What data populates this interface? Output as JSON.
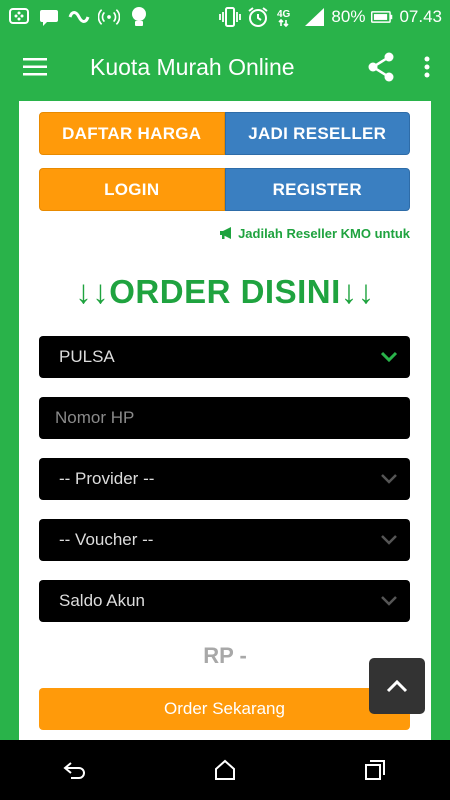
{
  "status_bar": {
    "icons_left": [
      "bbm-icon",
      "chat-icon",
      "sync-icon",
      "nfc-icon",
      "bulb-icon"
    ],
    "icons_right": [
      "vibrate-icon",
      "alarm-icon",
      "network-4g-icon",
      "signal-icon"
    ],
    "battery": "80%",
    "time": "07.43"
  },
  "app_bar": {
    "title": "Kuota Murah Online"
  },
  "buttons": {
    "daftar_harga": "DAFTAR HARGA",
    "jadi_reseller": "JADI RESELLER",
    "login": "LOGIN",
    "register": "REGISTER"
  },
  "notice": "Jadilah Reseller KMO untuk",
  "heading": "↓↓ORDER DISINI↓↓",
  "form": {
    "product": {
      "value": "PULSA"
    },
    "phone": {
      "placeholder": "Nomor HP"
    },
    "provider": {
      "value": "-- Provider --"
    },
    "voucher": {
      "value": "-- Voucher --"
    },
    "payment": {
      "value": "Saldo Akun"
    }
  },
  "total": "RP -",
  "order_button": "Order Sekarang",
  "colors": {
    "primary_green": "#29b34a",
    "text_green": "#1fa33f",
    "orange": "#ff9a0a",
    "blue": "#3a7fc1"
  }
}
